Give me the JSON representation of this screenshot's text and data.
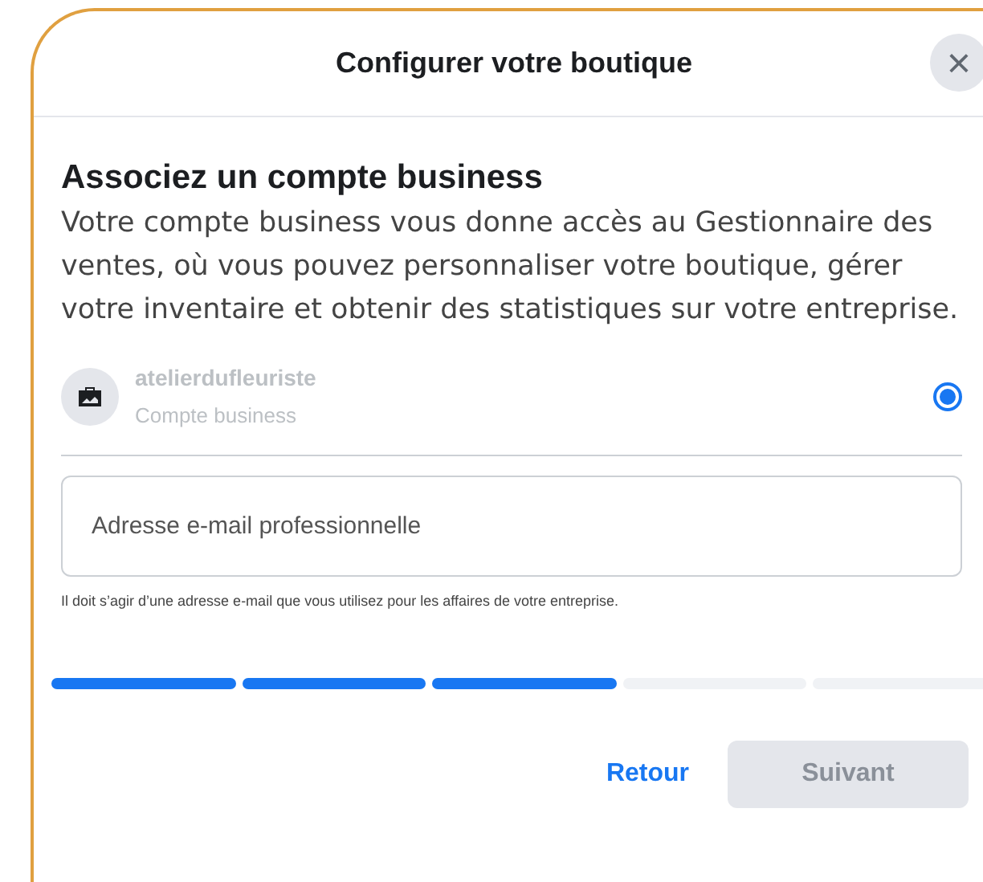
{
  "dialog": {
    "title": "Configurer votre boutique",
    "close": "×"
  },
  "heading": "Associez un compte business",
  "description": "Votre compte business vous donne accès au Gestionnaire des ventes, où vous pouvez personnaliser votre boutique, gérer votre inventaire et obtenir des statistiques sur votre entreprise.",
  "account": {
    "name": "atelierdufleuriste",
    "type": "Compte business",
    "selected": true,
    "disabled": true
  },
  "email_field": {
    "placeholder": "Adresse e-mail professionnelle"
  },
  "helper": "Il doit s’agir d’une adresse e-mail que vous utilisez pour les affaires de votre entreprise.",
  "progress": [
    {
      "completed": true
    },
    {
      "completed": true
    },
    {
      "completed": true
    },
    {
      "completed": false
    },
    {
      "completed": false
    }
  ],
  "buttons": [
    {
      "label": "Retour",
      "kind": "link",
      "disabled": false
    },
    {
      "label": "Suivant",
      "kind": "primary",
      "disabled": true
    }
  ]
}
